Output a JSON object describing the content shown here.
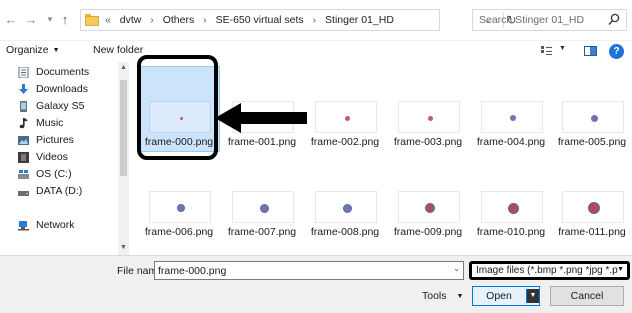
{
  "address_bar": {
    "overflow": "«",
    "breadcrumbs": [
      "dvtw",
      "Others",
      "SE-650 virtual sets",
      "Stinger 01_HD"
    ],
    "search_placeholder": "Search Stinger 01_HD"
  },
  "toolbar": {
    "organize_label": "Organize",
    "new_folder_label": "New folder"
  },
  "sidebar": {
    "items": [
      {
        "label": "Documents",
        "icon": "documents-icon"
      },
      {
        "label": "Downloads",
        "icon": "downloads-icon"
      },
      {
        "label": "Galaxy S5",
        "icon": "phone-icon"
      },
      {
        "label": "Music",
        "icon": "music-icon"
      },
      {
        "label": "Pictures",
        "icon": "pictures-icon"
      },
      {
        "label": "Videos",
        "icon": "videos-icon"
      },
      {
        "label": "OS (C:)",
        "icon": "drive-icon"
      },
      {
        "label": "DATA (D:)",
        "icon": "drive-icon"
      },
      {
        "label": "Network",
        "icon": "network-icon"
      }
    ]
  },
  "files": [
    {
      "name": "frame-000.png",
      "selected": true
    },
    {
      "name": "frame-001.png"
    },
    {
      "name": "frame-002.png"
    },
    {
      "name": "frame-003.png"
    },
    {
      "name": "frame-004.png"
    },
    {
      "name": "frame-005.png"
    },
    {
      "name": "frame-006.png"
    },
    {
      "name": "frame-007.png"
    },
    {
      "name": "frame-008.png"
    },
    {
      "name": "frame-009.png"
    },
    {
      "name": "frame-010.png"
    },
    {
      "name": "frame-011.png"
    }
  ],
  "footer": {
    "file_name_label": "File name:",
    "file_name_value": "frame-000.png",
    "file_type_value": "Image files (*.bmp *.png *jpg *.p",
    "tools_label": "Tools",
    "open_label": "Open",
    "cancel_label": "Cancel"
  },
  "colors": {
    "selection_bg": "#cce4fa",
    "accent": "#0078d7",
    "annotation": "#000000"
  }
}
